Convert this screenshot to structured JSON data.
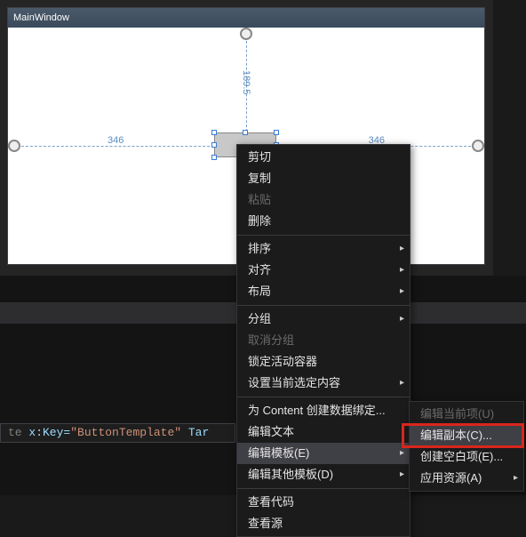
{
  "window": {
    "title": "MainWindow"
  },
  "margins": {
    "top": "189.5",
    "left": "346",
    "right": "346"
  },
  "xaml": {
    "prefix": "te ",
    "attr": "x:Key",
    "value": "ButtonTemplate",
    "tail": " Tar"
  },
  "menu": {
    "cut": "剪切",
    "copy": "复制",
    "paste": "粘贴",
    "delete": "删除",
    "order": "排序",
    "align": "对齐",
    "layout": "布局",
    "group": "分组",
    "ungroup": "取消分组",
    "lock_active_container": "锁定活动容器",
    "set_current_selection": "设置当前选定内容",
    "create_data_binding": "为 Content 创建数据绑定...",
    "edit_text": "编辑文本",
    "edit_template": "编辑模板(E)",
    "edit_other_templates": "编辑其他模板(D)",
    "view_code": "查看代码",
    "view_source": "查看源"
  },
  "submenu": {
    "edit_current": "编辑当前项(U)",
    "edit_copy": "编辑副本(C)...",
    "create_empty": "创建空白项(E)...",
    "apply_resource": "应用资源(A)"
  }
}
